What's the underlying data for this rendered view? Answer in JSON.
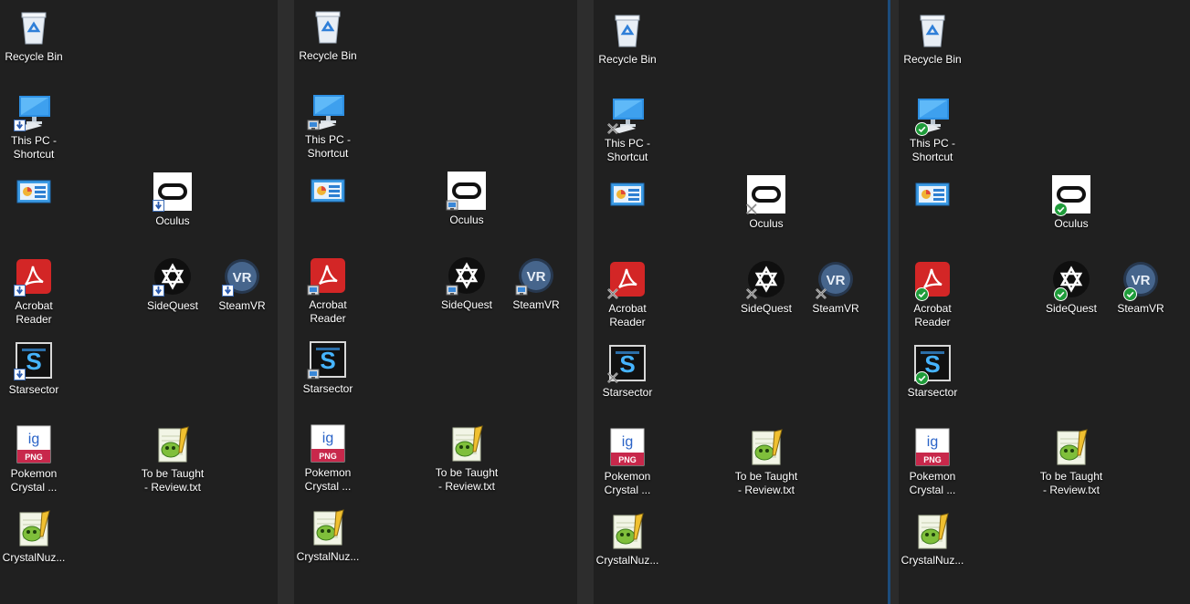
{
  "icons": {
    "recycle_bin": "Recycle Bin",
    "this_pc": "This PC -\nShortcut",
    "control_panel": "",
    "oculus": "Oculus",
    "acrobat": "Acrobat\nReader",
    "sidequest": "SideQuest",
    "steamvr": "SteamVR",
    "starsector": "Starsector",
    "pokemon": "Pokemon\nCrystal ...",
    "to_be_taught": "To be Taught\n- Review.txt",
    "crystalnuz": "CrystalNuz..."
  },
  "panels": [
    {
      "overlay": "sync"
    },
    {
      "overlay": "network"
    },
    {
      "overlay": "x"
    },
    {
      "overlay": "ok"
    }
  ],
  "png_badge": "PNG",
  "colors": {
    "desktop": "#202020",
    "ok_green": "#1f9c3a",
    "acrobat_red": "#d32626",
    "bin_blue": "#3d8ee0"
  }
}
